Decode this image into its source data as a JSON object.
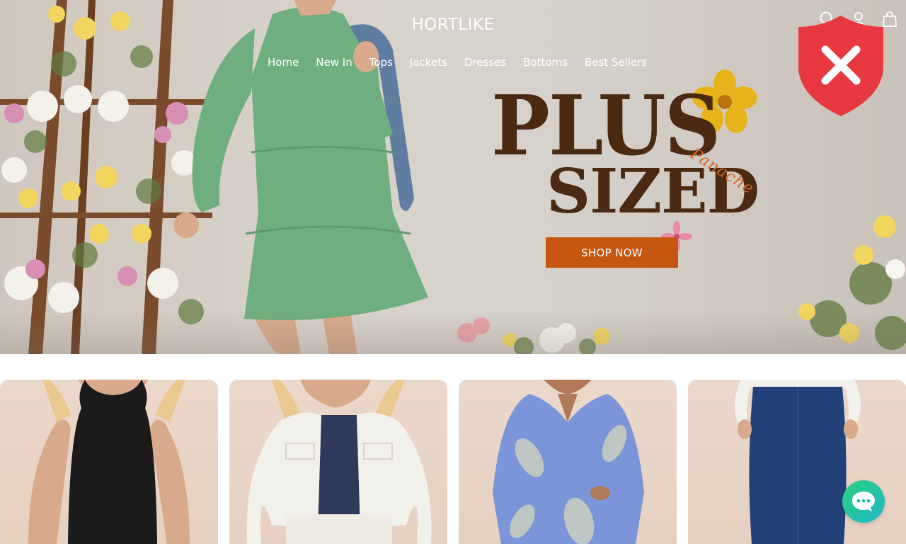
{
  "brand": {
    "logo": "HORTLIKE"
  },
  "nav": {
    "items": [
      {
        "label": "Home"
      },
      {
        "label": "New In"
      },
      {
        "label": "Tops"
      },
      {
        "label": "Jackets"
      },
      {
        "label": "Dresses"
      },
      {
        "label": "Bottoms"
      },
      {
        "label": "Best Sellers"
      }
    ]
  },
  "header_icons": [
    "search-icon",
    "account-icon",
    "cart-icon"
  ],
  "hero": {
    "headline_1": "PLUS",
    "headline_2": "SIZED",
    "script_text": "Panache",
    "cta_label": "SHOP NOW",
    "colors": {
      "headline": "#4a2a12",
      "script": "#d0682b",
      "cta": "#c65710"
    }
  },
  "security_badge": {
    "icon": "shield-x-icon",
    "color": "#e8383f"
  },
  "products": [
    {
      "image": "black-tank-top"
    },
    {
      "image": "white-denim-jacket"
    },
    {
      "image": "blue-print-dress"
    },
    {
      "image": "denim-midi-skirt"
    }
  ],
  "chat": {
    "icon": "chat-bubble-icon"
  }
}
